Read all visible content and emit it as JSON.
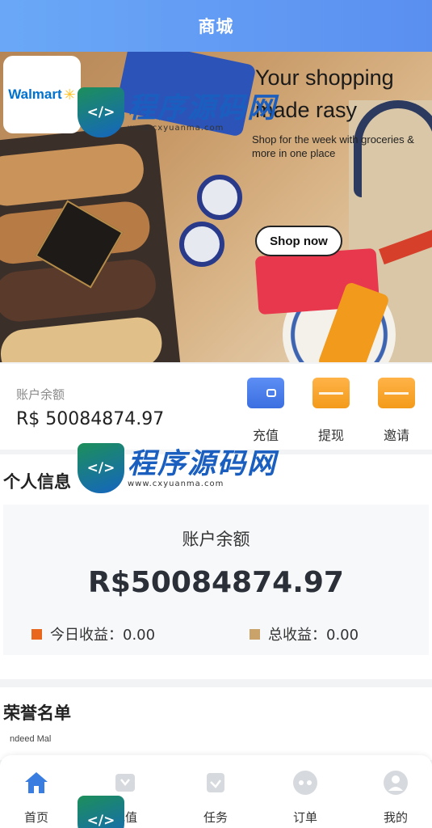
{
  "header": {
    "title": "商城"
  },
  "banner": {
    "brand": "Walmart",
    "headline": "Your shopping made rasy",
    "subline": "Shop for the week with groceries & more in one place",
    "cta": "Shop now",
    "page_dots": 4,
    "active_dot": 1
  },
  "watermark": {
    "title": "程序源码网",
    "url": "www.cxyuanma.com"
  },
  "balance": {
    "label": "账户余额",
    "value": "R$ 50084874.97",
    "actions": [
      {
        "label": "充值",
        "icon": "wallet-icon",
        "color": "#4f82ee"
      },
      {
        "label": "提现",
        "icon": "card-icon",
        "color": "#f7a531"
      },
      {
        "label": "邀请",
        "icon": "card-icon",
        "color": "#f7a531"
      }
    ]
  },
  "personal": {
    "title": "个人信息",
    "balance_label": "账户余额",
    "balance_value": "R$50084874.97",
    "today_label": "今日收益：0.00",
    "total_label": "总收益：0.00",
    "today_color": "#e8671d",
    "total_color": "#c9a36a"
  },
  "honor": {
    "title": "荣誉名单",
    "item_text": "ndeed Mal"
  },
  "tabbar": {
    "items": [
      {
        "label": "首页",
        "icon": "home-icon",
        "active": true
      },
      {
        "label": "充值",
        "icon": "recharge-icon",
        "active": false
      },
      {
        "label": "任务",
        "icon": "task-icon",
        "active": false
      },
      {
        "label": "订单",
        "icon": "order-icon",
        "active": false
      },
      {
        "label": "我的",
        "icon": "user-icon",
        "active": false
      }
    ]
  }
}
